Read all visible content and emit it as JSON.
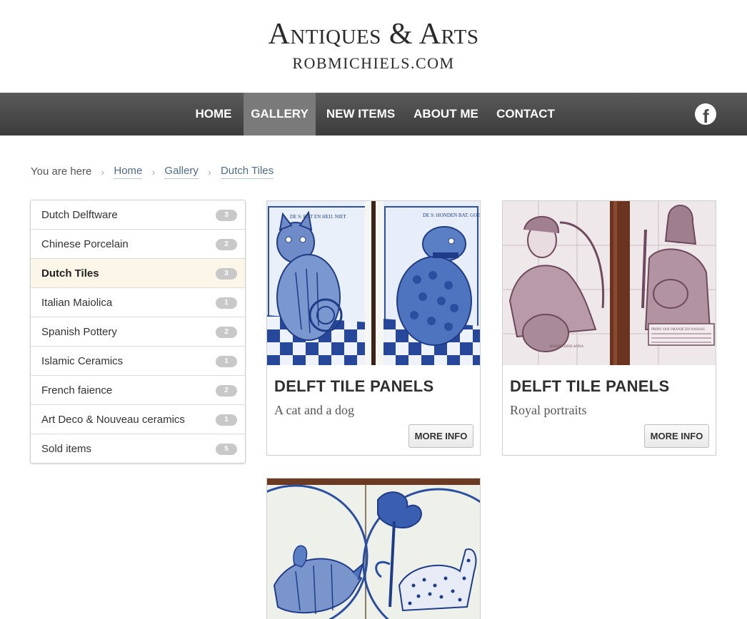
{
  "header": {
    "title": "Antiques & Arts",
    "subtitle": "ROBMICHIELS.COM"
  },
  "nav": {
    "items": [
      {
        "label": "HOME"
      },
      {
        "label": "GALLERY"
      },
      {
        "label": "NEW ITEMS"
      },
      {
        "label": "ABOUT ME"
      },
      {
        "label": "CONTACT"
      }
    ],
    "active": "GALLERY",
    "social_icon": "facebook-icon"
  },
  "breadcrumb": {
    "prefix": "You are here",
    "items": [
      "Home",
      "Gallery",
      "Dutch Tiles"
    ]
  },
  "sidebar": {
    "categories": [
      {
        "label": "Dutch Delftware",
        "count": "3"
      },
      {
        "label": "Chinese Porcelain",
        "count": "2"
      },
      {
        "label": "Dutch Tiles",
        "count": "3"
      },
      {
        "label": "Italian Maiolica",
        "count": "1"
      },
      {
        "label": "Spanish Pottery",
        "count": "2"
      },
      {
        "label": "Islamic Ceramics",
        "count": "1"
      },
      {
        "label": "French faience",
        "count": "2"
      },
      {
        "label": "Art Deco & Nouveau ceramics",
        "count": "1"
      },
      {
        "label": "Sold items",
        "count": "5"
      }
    ],
    "active": "Dutch Tiles"
  },
  "cards": [
    {
      "title": "DELFT TILE PANELS",
      "subtitle": "A cat and a dog",
      "button": "MORE INFO",
      "image": "delft-tiles-cat-and-dog"
    },
    {
      "title": "DELFT TILE PANELS",
      "subtitle": "Royal portraits",
      "button": "MORE INFO",
      "image": "delft-tiles-royal-portraits"
    },
    {
      "title": "",
      "subtitle": "",
      "button": "",
      "image": "delft-tiles-rhino-and-leopard"
    }
  ],
  "tile_art": {
    "cat_dog": {
      "cat_caption": "DE S: KAT EN HEIJ. NIET",
      "dog_caption": "DE S: HONDEN BAT. GOET."
    },
    "portraits": {
      "left_caption": "KONINGINNE ANNA",
      "right_caption": "PRINS VAN ORANJE EN NASSAU"
    }
  },
  "colors": {
    "nav_bg": "#4a4a4a",
    "nav_active": "#7a7a7a",
    "link": "#4f6d8e",
    "active_category_bg": "#fcf6e8",
    "badge": "#c8c8c8",
    "delft_blue": "#2a4fa0",
    "manganese": "#6e4a5c"
  }
}
